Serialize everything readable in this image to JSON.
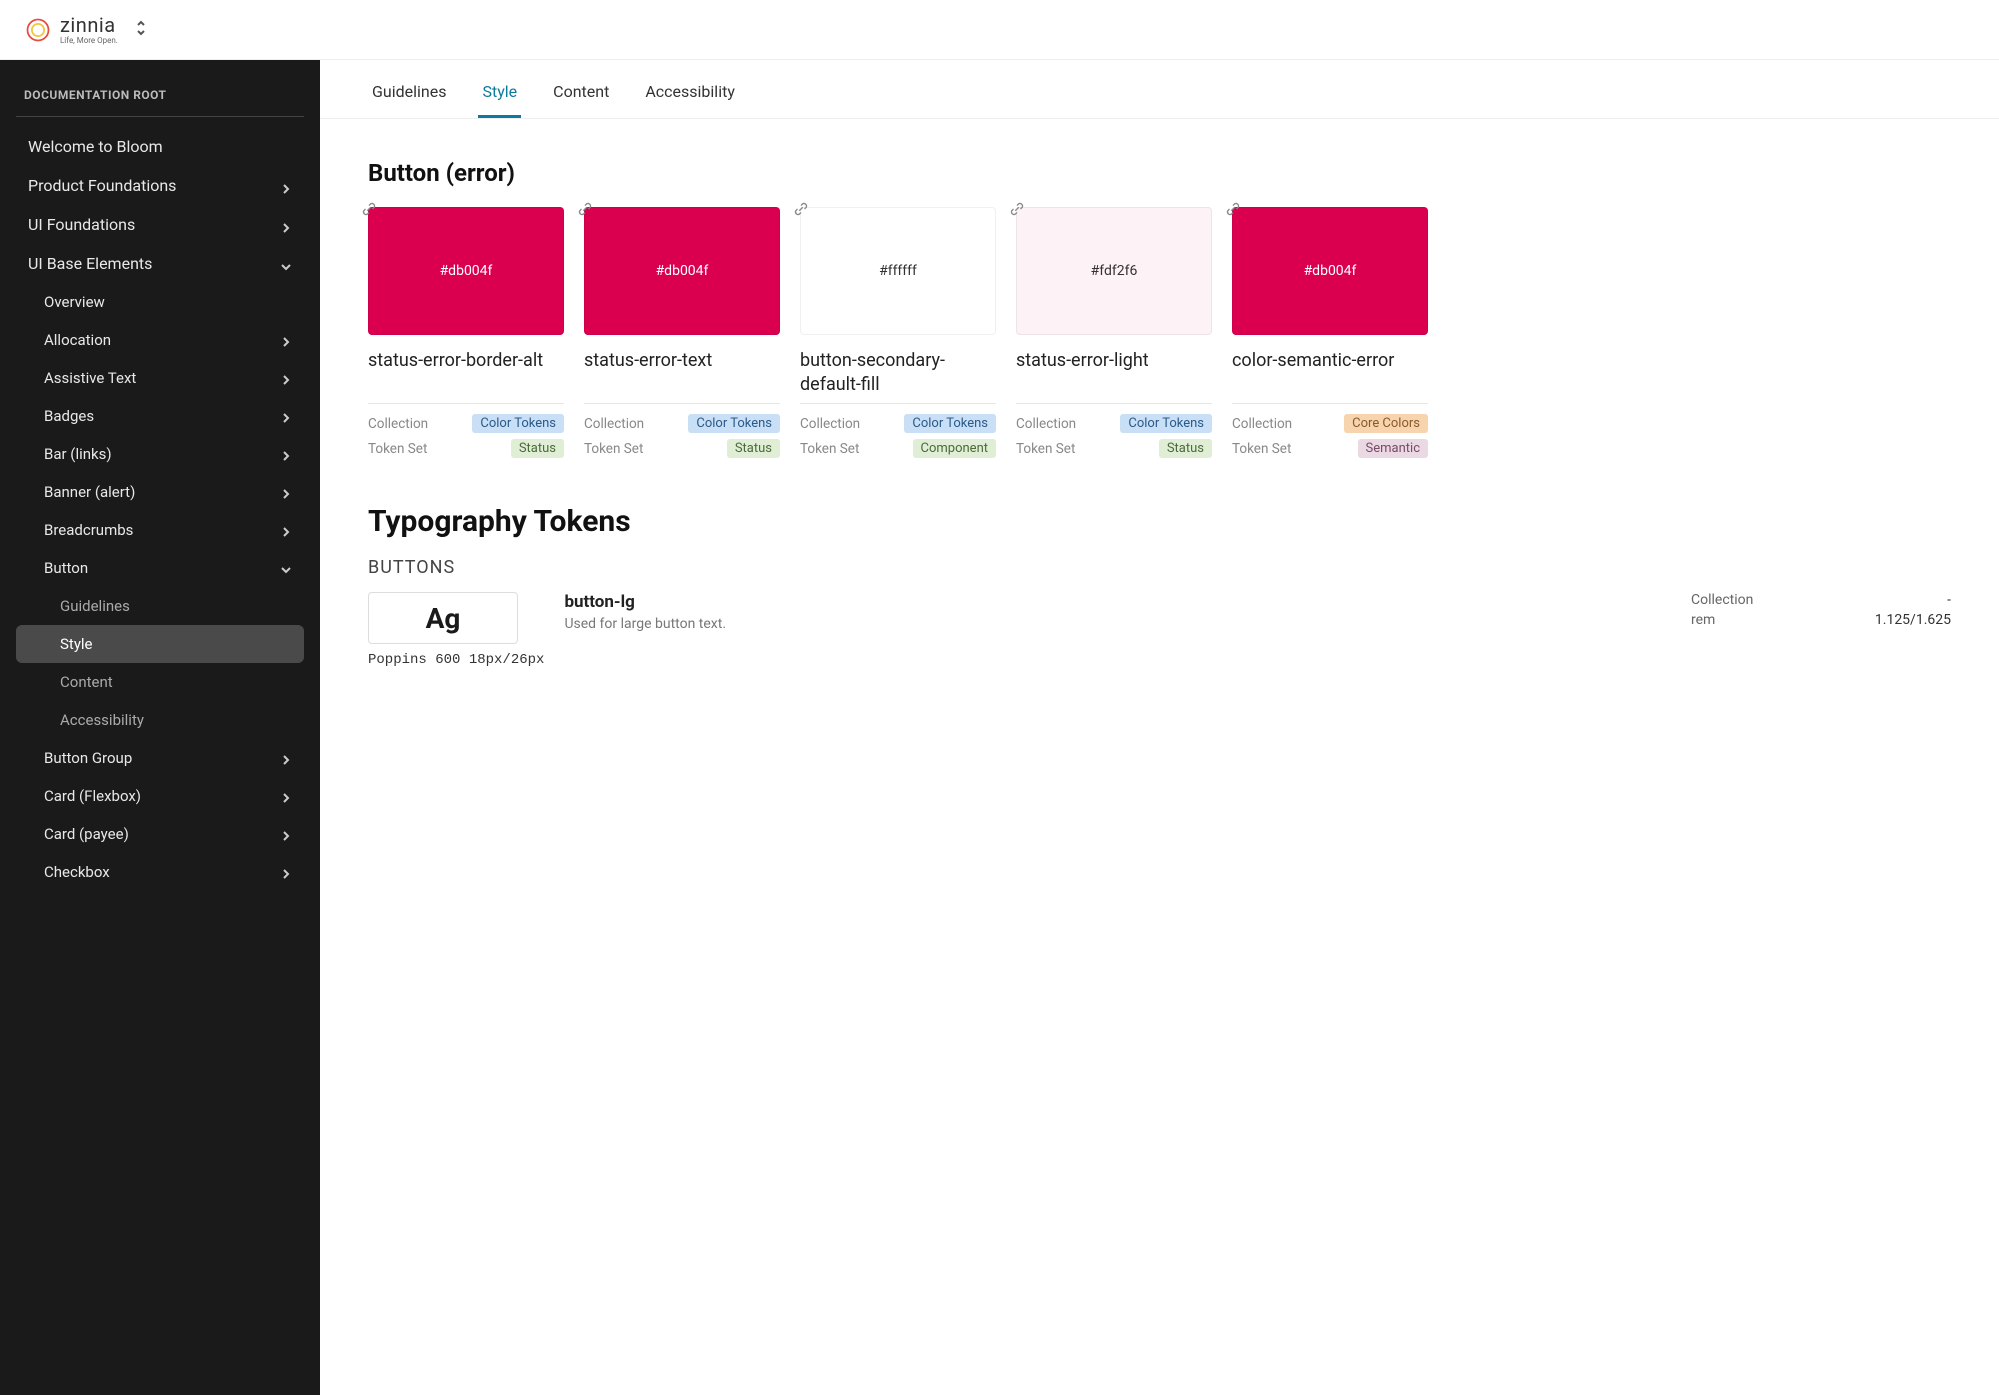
{
  "header": {
    "brand": "zinnia",
    "tagline": "Life, More Open."
  },
  "sidebar": {
    "heading": "DOCUMENTATION ROOT",
    "items": [
      {
        "label": "Welcome to Bloom",
        "expandable": false
      },
      {
        "label": "Product Foundations",
        "expandable": true,
        "open": false
      },
      {
        "label": "UI Foundations",
        "expandable": true,
        "open": false
      },
      {
        "label": "UI Base Elements",
        "expandable": true,
        "open": true
      },
      {
        "label": "Overview",
        "level": 1
      },
      {
        "label": "Allocation",
        "level": 1,
        "expandable": true
      },
      {
        "label": "Assistive Text",
        "level": 1,
        "expandable": true
      },
      {
        "label": "Badges",
        "level": 1,
        "expandable": true
      },
      {
        "label": "Bar (links)",
        "level": 1,
        "expandable": true
      },
      {
        "label": "Banner (alert)",
        "level": 1,
        "expandable": true
      },
      {
        "label": "Breadcrumbs",
        "level": 1,
        "expandable": true
      },
      {
        "label": "Button",
        "level": 1,
        "expandable": true,
        "open": true
      },
      {
        "label": "Guidelines",
        "level": 2
      },
      {
        "label": "Style",
        "level": 2,
        "active": true
      },
      {
        "label": "Content",
        "level": 2
      },
      {
        "label": "Accessibility",
        "level": 2
      },
      {
        "label": "Button Group",
        "level": 1,
        "expandable": true
      },
      {
        "label": "Card (Flexbox)",
        "level": 1,
        "expandable": true
      },
      {
        "label": "Card (payee)",
        "level": 1,
        "expandable": true
      },
      {
        "label": "Checkbox",
        "level": 1,
        "expandable": true
      }
    ]
  },
  "tabs": [
    {
      "label": "Guidelines"
    },
    {
      "label": "Style",
      "active": true
    },
    {
      "label": "Content"
    },
    {
      "label": "Accessibility"
    }
  ],
  "section": {
    "title": "Button (error)",
    "cards": [
      {
        "hex": "#db004f",
        "bg": "#db004f",
        "text_light": true,
        "name": "status-error-border-alt",
        "collection": "Color Tokens",
        "tokenset": "Status",
        "coll_badge": "blue",
        "set_badge": "green"
      },
      {
        "hex": "#db004f",
        "bg": "#db004f",
        "text_light": true,
        "name": "status-error-text",
        "collection": "Color Tokens",
        "tokenset": "Status",
        "coll_badge": "blue",
        "set_badge": "green"
      },
      {
        "hex": "#ffffff",
        "bg": "#ffffff",
        "text_light": false,
        "name": "button-secondary-default-fill",
        "collection": "Color Tokens",
        "tokenset": "Component",
        "coll_badge": "blue",
        "set_badge": "green"
      },
      {
        "hex": "#fdf2f6",
        "bg": "#fdf2f6",
        "text_light": false,
        "name": "status-error-light",
        "collection": "Color Tokens",
        "tokenset": "Status",
        "coll_badge": "blue",
        "set_badge": "green"
      },
      {
        "hex": "#db004f",
        "bg": "#db004f",
        "text_light": true,
        "name": "color-semantic-error",
        "collection": "Core Colors",
        "tokenset": "Semantic",
        "coll_badge": "orange",
        "set_badge": "mauve"
      }
    ]
  },
  "typography": {
    "title": "Typography Tokens",
    "subtitle": "BUTTONS",
    "sample": "Ag",
    "spec": "Poppins 600 18px/26px",
    "token_name": "button-lg",
    "desc": "Used for large button text.",
    "meta": {
      "collection_label": "Collection",
      "collection_value": "-",
      "rem_label": "rem",
      "rem_value": "1.125/1.625"
    }
  },
  "labels": {
    "collection": "Collection",
    "tokenset": "Token Set"
  }
}
